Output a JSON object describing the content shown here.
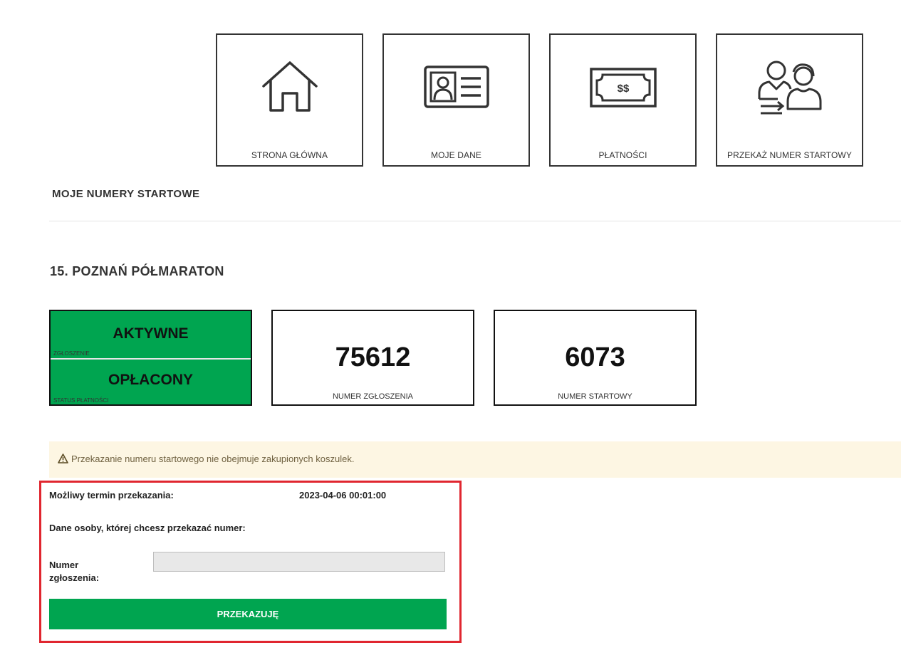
{
  "nav": {
    "tiles": [
      {
        "label": "STRONA GŁÓWNA",
        "icon": "home-icon"
      },
      {
        "label": "MOJE DANE",
        "icon": "id-card-icon"
      },
      {
        "label": "PŁATNOŚCI",
        "icon": "banknote-icon"
      },
      {
        "label": "PRZEKAŻ NUMER STARTOWY",
        "icon": "transfer-users-icon"
      }
    ]
  },
  "section": {
    "title": "MOJE NUMERY STARTOWE"
  },
  "event": {
    "title": "15. POZNAŃ PÓŁMARATON",
    "registration_status": "AKTYWNE",
    "registration_status_caption": "ZGŁOSZENIE",
    "payment_status": "OPŁACONY",
    "payment_status_caption": "STATUS PŁATNOŚCI",
    "registration_number": "75612",
    "registration_number_caption": "NUMER ZGŁOSZENIA",
    "start_number": "6073",
    "start_number_caption": "NUMER STARTOWY"
  },
  "warning": {
    "icon": "warning-triangle-icon",
    "text": "Przekazanie numeru startowego nie obejmuje zakupionych koszulek."
  },
  "transfer": {
    "deadline_label": "Możliwy termin przekazania:",
    "deadline_value": "2023-04-06 00:01:00",
    "recipient_heading": "Dane osoby, której chcesz przekazać numer:",
    "registration_field_label_line1": "Numer",
    "registration_field_label_line2": "zgłoszenia:",
    "registration_field_value": "",
    "submit_label": "PRZEKAZUJĘ"
  },
  "colors": {
    "status_green": "#00a550",
    "warning_bg": "#fdf6e3",
    "highlight_border": "#e0262f",
    "tile_border": "#333333"
  }
}
